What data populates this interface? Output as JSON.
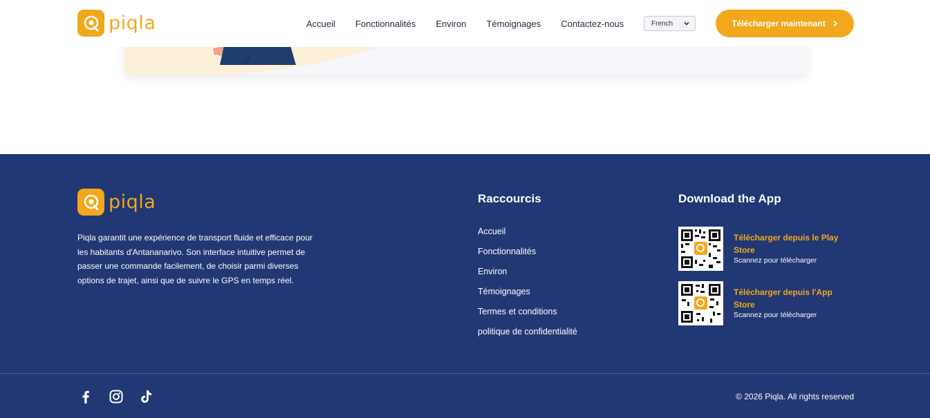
{
  "brand": {
    "name": "piqla",
    "color": "#f2a81d"
  },
  "header": {
    "nav": [
      "Accueil",
      "Fonctionnalités",
      "Environ",
      "Témoignages",
      "Contactez-nous"
    ],
    "language": "French",
    "cta_label": "Télécharger maintenant"
  },
  "footer": {
    "about": "Piqla garantit une expérience de transport fluide et efficace pour les habitants d'Antananarivo. Son interface intuitive permet de passer une commande facilement, de choisir parmi diverses options de trajet, ainsi que de suivre le GPS en temps réel.",
    "shortcuts_title": "Raccourcis",
    "shortcuts": [
      "Accueil",
      "Fonctionnalités",
      "Environ",
      "Témoignages",
      "Termes et conditions",
      "politique de confidentialité"
    ],
    "download_title": "Download the App",
    "downloads": [
      {
        "title": "Télécharger depuis le Play Store",
        "subtitle": "Scannez pour télécharger"
      },
      {
        "title": "Télécharger depuis l'App Store",
        "subtitle": "Scannez pour télécharger"
      }
    ],
    "social_icons": [
      "facebook-icon",
      "instagram-icon",
      "tiktok-icon"
    ],
    "copyright": "© 2026 Piqla. All rights reserved"
  },
  "colors": {
    "accent": "#f2a81d",
    "footer_bg": "#213874",
    "text_dark": "#222b3d"
  }
}
